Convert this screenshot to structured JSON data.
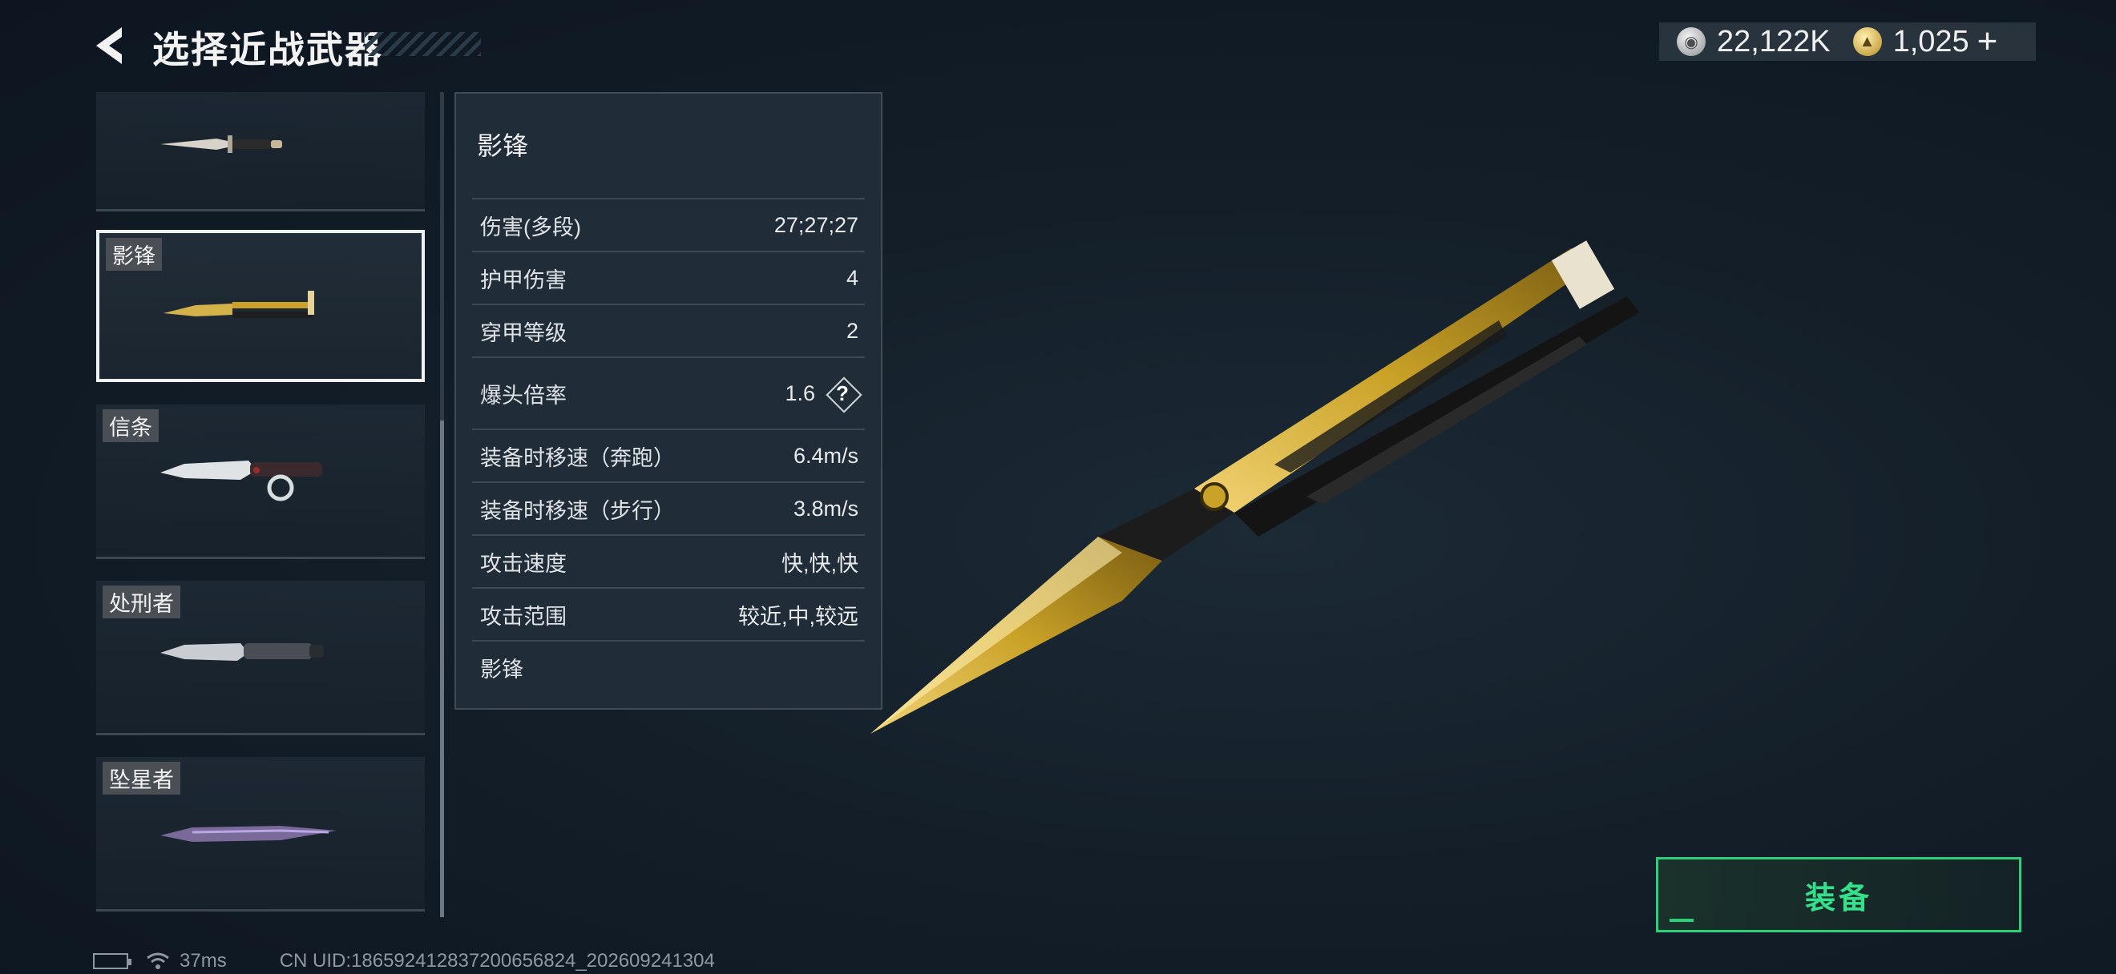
{
  "header": {
    "title": "选择近战武器",
    "currency": [
      {
        "icon": "silver-coin-icon",
        "value": "22,122K"
      },
      {
        "icon": "gold-coin-icon",
        "value": "1,025"
      }
    ],
    "add_label": "+"
  },
  "weapon_list": {
    "items": [
      {
        "label": "",
        "knife_icon": "combat-knife-icon"
      },
      {
        "label": "影锋",
        "knife_icon": "butterfly-knife-icon",
        "selected": true
      },
      {
        "label": "信条",
        "knife_icon": "serrated-knife-icon"
      },
      {
        "label": "处刑者",
        "knife_icon": "tactical-knife-icon"
      },
      {
        "label": "坠星者",
        "knife_icon": "purple-blade-icon"
      }
    ]
  },
  "stats_panel": {
    "name": "影锋",
    "rows": [
      {
        "label": "伤害(多段)",
        "value": "27;27;27"
      },
      {
        "label": "护甲伤害",
        "value": "4"
      },
      {
        "label": "穿甲等级",
        "value": "2"
      },
      {
        "label": "爆头倍率",
        "value": "1.6",
        "help": "?"
      },
      {
        "label": "装备时移速（奔跑）",
        "value": "6.4m/s"
      },
      {
        "label": "装备时移速（步行）",
        "value": "3.8m/s"
      },
      {
        "label": "攻击速度",
        "value": "快,快,快"
      },
      {
        "label": "攻击范围",
        "value": "较近,中,较远"
      }
    ],
    "footer": "影锋"
  },
  "equip_button": {
    "label": "装备"
  },
  "status_bar": {
    "ping": "37ms",
    "uid": "CN UID:18659241283720065682​4_202609241304"
  },
  "colors": {
    "accent_green": "#2bd17a",
    "gold": "#c9a227",
    "panel_bg": "#222e3a"
  }
}
